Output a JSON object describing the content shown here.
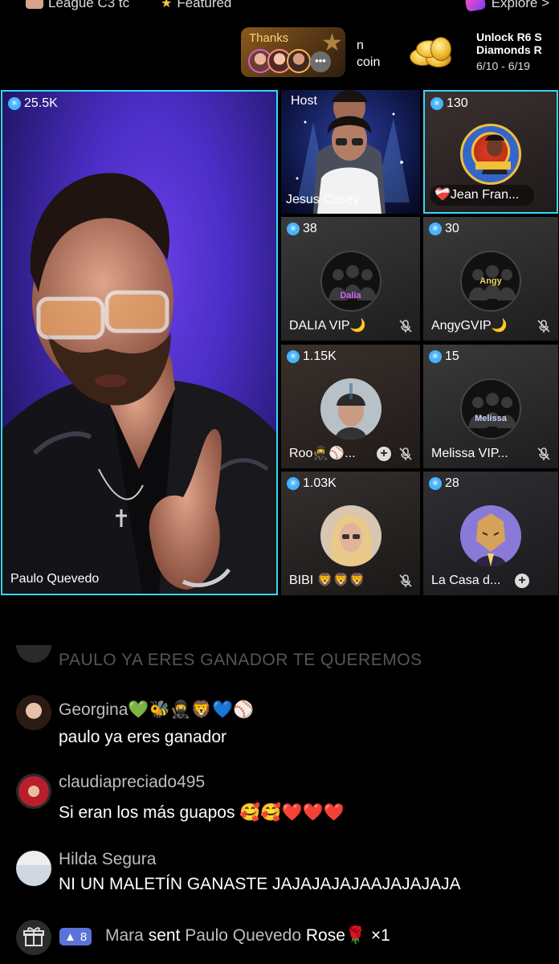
{
  "top": {
    "league": "League C3 tc",
    "featured": "Featured",
    "explore": "Explore >"
  },
  "banner": {
    "thanks": "Thanks",
    "more": "•••",
    "coin_line1": "n",
    "coin_line2": "coin",
    "unlock_line1": "Unlock R6 S",
    "unlock_line2": "Diamonds R",
    "dates": "6/10 - 6/19"
  },
  "main": {
    "count": "25.5K",
    "name": "Paulo Quevedo"
  },
  "cells": [
    {
      "id": "host",
      "tag": "Host",
      "name": "Jesus Casey"
    },
    {
      "id": "jean",
      "count": "130",
      "name": "❤️‍🩹Jean Fran..."
    },
    {
      "id": "dalia",
      "count": "38",
      "name": "DALIA VIP🌙",
      "logo_word": "Dalia"
    },
    {
      "id": "angy",
      "count": "30",
      "name": "AngyGVIP🌙",
      "logo_word": "Angy"
    },
    {
      "id": "roo",
      "count": "1.15K",
      "name": "Roo🥷⚾..."
    },
    {
      "id": "melissa",
      "count": "15",
      "name": "Melissa VIP...",
      "logo_word": "Melissa"
    },
    {
      "id": "bibi",
      "count": "1.03K",
      "name": "BIBI 🦁🦁🦁"
    },
    {
      "id": "casa",
      "count": "28",
      "name": "La Casa d..."
    }
  ],
  "chat": {
    "ghost": "PAULO YA ERES GANADOR TE QUEREMOS",
    "messages": [
      {
        "user": "Georgina💚🐝🥷🦁💙⚾",
        "text": "paulo ya eres ganador"
      },
      {
        "user": "claudiapreciado495",
        "text": "Si eran los más guapos 🥰🥰❤️❤️❤️"
      },
      {
        "user": "Hilda Segura",
        "text": "NI UN MALETÍN GANASTE JAJAJAJAJAAJAJAJAJA"
      }
    ],
    "gift": {
      "level": "8",
      "sender": "Mara",
      "verb": "sent",
      "recipient": "Paulo Quevedo",
      "item": "Rose🌹",
      "qty": "×1"
    }
  },
  "colors": {
    "accent": "#37d5ff",
    "badge": "#45b4ff",
    "level_badge": "#5a73d8"
  }
}
